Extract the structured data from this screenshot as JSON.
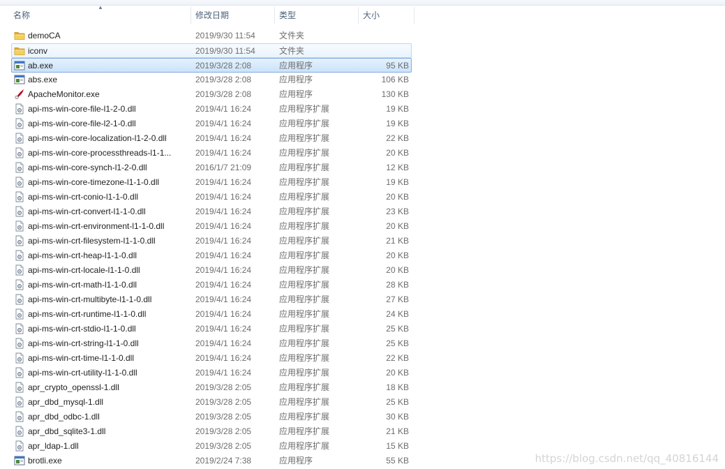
{
  "columns": {
    "name": "名称",
    "date": "修改日期",
    "type": "类型",
    "size": "大小"
  },
  "files": [
    {
      "name": "demoCA",
      "date": "2019/9/30 11:54",
      "type": "文件夹",
      "size": "",
      "icon": "folder-icon"
    },
    {
      "name": "iconv",
      "date": "2019/9/30 11:54",
      "type": "文件夹",
      "size": "",
      "icon": "folder-icon",
      "state": "hover"
    },
    {
      "name": "ab.exe",
      "date": "2019/3/28 2:08",
      "type": "应用程序",
      "size": "95 KB",
      "icon": "exe-icon",
      "state": "selected"
    },
    {
      "name": "abs.exe",
      "date": "2019/3/28 2:08",
      "type": "应用程序",
      "size": "106 KB",
      "icon": "exe-icon"
    },
    {
      "name": "ApacheMonitor.exe",
      "date": "2019/3/28 2:08",
      "type": "应用程序",
      "size": "130 KB",
      "icon": "apache-feather-icon"
    },
    {
      "name": "api-ms-win-core-file-l1-2-0.dll",
      "date": "2019/4/1 16:24",
      "type": "应用程序扩展",
      "size": "19 KB",
      "icon": "dll-icon"
    },
    {
      "name": "api-ms-win-core-file-l2-1-0.dll",
      "date": "2019/4/1 16:24",
      "type": "应用程序扩展",
      "size": "19 KB",
      "icon": "dll-icon"
    },
    {
      "name": "api-ms-win-core-localization-l1-2-0.dll",
      "date": "2019/4/1 16:24",
      "type": "应用程序扩展",
      "size": "22 KB",
      "icon": "dll-icon"
    },
    {
      "name": "api-ms-win-core-processthreads-l1-1...",
      "date": "2019/4/1 16:24",
      "type": "应用程序扩展",
      "size": "20 KB",
      "icon": "dll-icon"
    },
    {
      "name": "api-ms-win-core-synch-l1-2-0.dll",
      "date": "2016/1/7 21:09",
      "type": "应用程序扩展",
      "size": "12 KB",
      "icon": "dll-icon"
    },
    {
      "name": "api-ms-win-core-timezone-l1-1-0.dll",
      "date": "2019/4/1 16:24",
      "type": "应用程序扩展",
      "size": "19 KB",
      "icon": "dll-icon"
    },
    {
      "name": "api-ms-win-crt-conio-l1-1-0.dll",
      "date": "2019/4/1 16:24",
      "type": "应用程序扩展",
      "size": "20 KB",
      "icon": "dll-icon"
    },
    {
      "name": "api-ms-win-crt-convert-l1-1-0.dll",
      "date": "2019/4/1 16:24",
      "type": "应用程序扩展",
      "size": "23 KB",
      "icon": "dll-icon"
    },
    {
      "name": "api-ms-win-crt-environment-l1-1-0.dll",
      "date": "2019/4/1 16:24",
      "type": "应用程序扩展",
      "size": "20 KB",
      "icon": "dll-icon"
    },
    {
      "name": "api-ms-win-crt-filesystem-l1-1-0.dll",
      "date": "2019/4/1 16:24",
      "type": "应用程序扩展",
      "size": "21 KB",
      "icon": "dll-icon"
    },
    {
      "name": "api-ms-win-crt-heap-l1-1-0.dll",
      "date": "2019/4/1 16:24",
      "type": "应用程序扩展",
      "size": "20 KB",
      "icon": "dll-icon"
    },
    {
      "name": "api-ms-win-crt-locale-l1-1-0.dll",
      "date": "2019/4/1 16:24",
      "type": "应用程序扩展",
      "size": "20 KB",
      "icon": "dll-icon"
    },
    {
      "name": "api-ms-win-crt-math-l1-1-0.dll",
      "date": "2019/4/1 16:24",
      "type": "应用程序扩展",
      "size": "28 KB",
      "icon": "dll-icon"
    },
    {
      "name": "api-ms-win-crt-multibyte-l1-1-0.dll",
      "date": "2019/4/1 16:24",
      "type": "应用程序扩展",
      "size": "27 KB",
      "icon": "dll-icon"
    },
    {
      "name": "api-ms-win-crt-runtime-l1-1-0.dll",
      "date": "2019/4/1 16:24",
      "type": "应用程序扩展",
      "size": "24 KB",
      "icon": "dll-icon"
    },
    {
      "name": "api-ms-win-crt-stdio-l1-1-0.dll",
      "date": "2019/4/1 16:24",
      "type": "应用程序扩展",
      "size": "25 KB",
      "icon": "dll-icon"
    },
    {
      "name": "api-ms-win-crt-string-l1-1-0.dll",
      "date": "2019/4/1 16:24",
      "type": "应用程序扩展",
      "size": "25 KB",
      "icon": "dll-icon"
    },
    {
      "name": "api-ms-win-crt-time-l1-1-0.dll",
      "date": "2019/4/1 16:24",
      "type": "应用程序扩展",
      "size": "22 KB",
      "icon": "dll-icon"
    },
    {
      "name": "api-ms-win-crt-utility-l1-1-0.dll",
      "date": "2019/4/1 16:24",
      "type": "应用程序扩展",
      "size": "20 KB",
      "icon": "dll-icon"
    },
    {
      "name": "apr_crypto_openssl-1.dll",
      "date": "2019/3/28 2:05",
      "type": "应用程序扩展",
      "size": "18 KB",
      "icon": "dll-icon"
    },
    {
      "name": "apr_dbd_mysql-1.dll",
      "date": "2019/3/28 2:05",
      "type": "应用程序扩展",
      "size": "25 KB",
      "icon": "dll-icon"
    },
    {
      "name": "apr_dbd_odbc-1.dll",
      "date": "2019/3/28 2:05",
      "type": "应用程序扩展",
      "size": "30 KB",
      "icon": "dll-icon"
    },
    {
      "name": "apr_dbd_sqlite3-1.dll",
      "date": "2019/3/28 2:05",
      "type": "应用程序扩展",
      "size": "21 KB",
      "icon": "dll-icon"
    },
    {
      "name": "apr_ldap-1.dll",
      "date": "2019/3/28 2:05",
      "type": "应用程序扩展",
      "size": "15 KB",
      "icon": "dll-icon"
    },
    {
      "name": "brotli.exe",
      "date": "2019/2/24 7:38",
      "type": "应用程序",
      "size": "55 KB",
      "icon": "exe-icon"
    }
  ],
  "watermark": "https://blog.csdn.net/qq_40816144",
  "colors": {
    "header_text": "#4c607a",
    "meta_text": "#6d6d6d",
    "selection_border": "#84acdd",
    "hover_border": "#b8d6fb",
    "folder": "#e8b73c"
  }
}
